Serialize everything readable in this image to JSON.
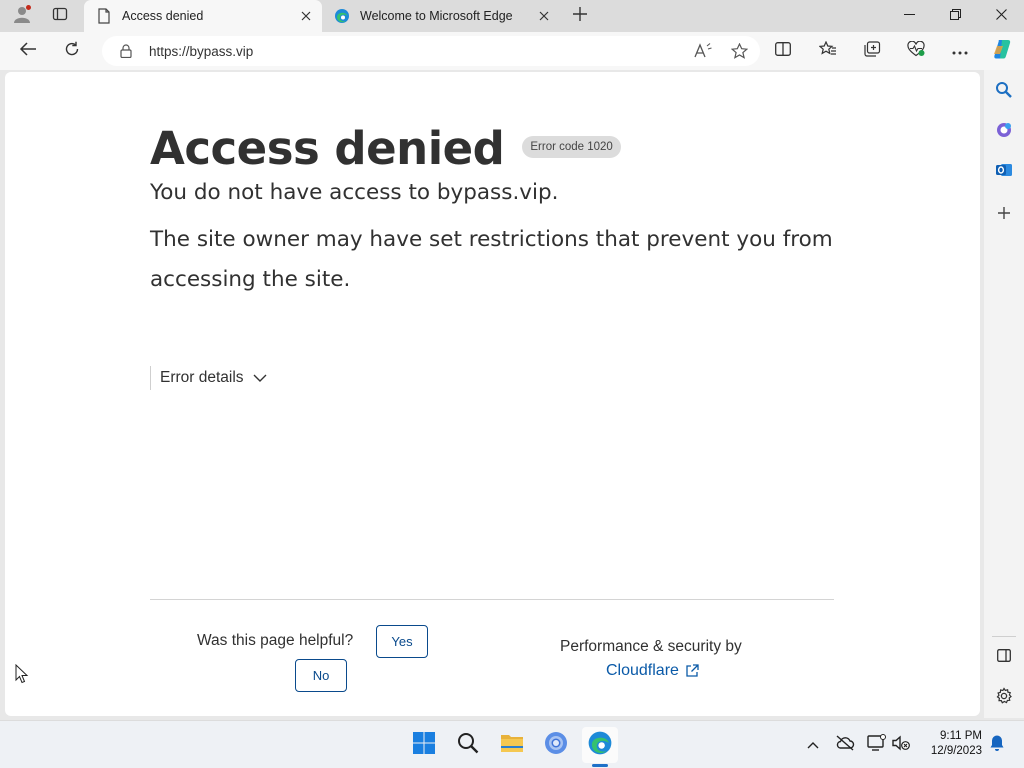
{
  "browser": {
    "tabs": [
      {
        "title": "Access denied",
        "active": true
      },
      {
        "title": "Welcome to Microsoft Edge",
        "active": false
      }
    ],
    "address": {
      "url": "https://bypass.vip"
    }
  },
  "page": {
    "headline": "Access denied",
    "error_badge": "Error code 1020",
    "message_line1": "You do not have access to bypass.vip.",
    "message_line2": "The site owner may have set restrictions that prevent you from accessing the site.",
    "error_details_label": "Error details",
    "feedback": {
      "question": "Was this page helpful?",
      "yes_label": "Yes",
      "no_label": "No"
    },
    "footer": {
      "performance_text": "Performance & security by",
      "cloudflare_link": "Cloudflare"
    }
  },
  "taskbar": {
    "clock_time": "9:11 PM",
    "clock_date": "12/9/2023"
  },
  "colors": {
    "accent": "#0a4a8c",
    "link": "#0a5aa8",
    "badge_bg": "#dcdcdc"
  },
  "icons": {
    "tab_actions": "vertical-tabs-icon",
    "profile": "profile-icon",
    "page": "page-icon",
    "edge": "edge-icon",
    "copilot": "copilot-icon",
    "outlook": "outlook-icon"
  }
}
